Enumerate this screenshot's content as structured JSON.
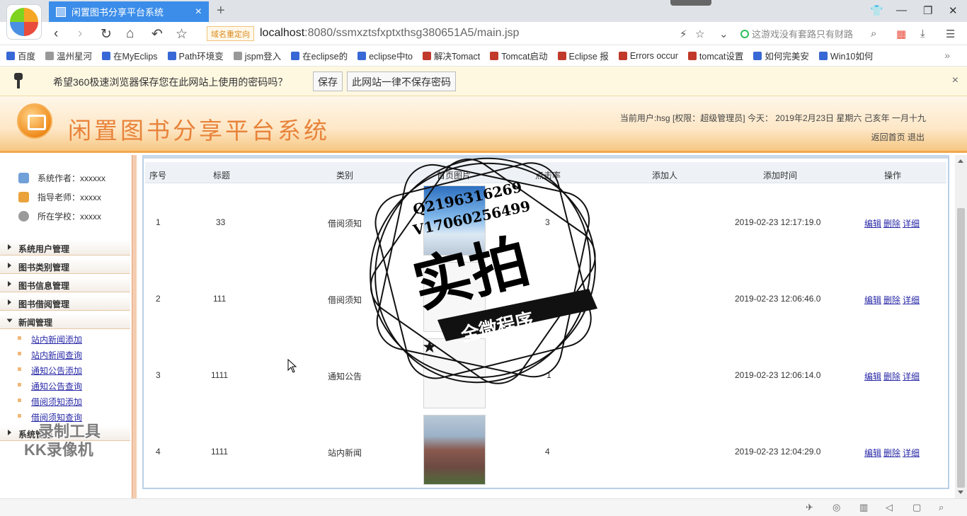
{
  "browser": {
    "tab_title": "闲置图书分享平台系统",
    "tab_close": "×",
    "new_tab": "+",
    "redirect_badge": "域名重定向",
    "url_host": "localhost",
    "url_path": ":8080/ssmxztsfxptxthsg380651A5/main.jsp",
    "search_placeholder": "这游戏没有套路只有财路",
    "bookmarks": [
      {
        "label": "百度",
        "color": "#3867d6"
      },
      {
        "label": "温州星河",
        "color": "#999999"
      },
      {
        "label": "在MyEclips",
        "color": "#3867d6"
      },
      {
        "label": "Path环境变",
        "color": "#3867d6"
      },
      {
        "label": "jspm登入",
        "color": "#999999"
      },
      {
        "label": "在eclipse的",
        "color": "#3867d6"
      },
      {
        "label": "eclipse中to",
        "color": "#3867d6"
      },
      {
        "label": "解决Tomact",
        "color": "#c0392b"
      },
      {
        "label": "Tomcat启动",
        "color": "#c0392b"
      },
      {
        "label": "Eclipse 报",
        "color": "#c0392b"
      },
      {
        "label": "Errors occur",
        "color": "#c0392b"
      },
      {
        "label": "tomcat设置",
        "color": "#c0392b"
      },
      {
        "label": "如何完美安",
        "color": "#3867d6"
      },
      {
        "label": "Win10如何",
        "color": "#3867d6"
      }
    ],
    "bookmarks_more": "»",
    "password_prompt": "希望360极速浏览器保存您在此网站上使用的密码吗？",
    "save_label": "保存",
    "never_save_label": "此网站一律不保存密码",
    "close_glyph": "×"
  },
  "app": {
    "title": "闲置图书分享平台系统",
    "user_info": "当前用户:hsg [权限：超级管理员] 今天： 2019年2月23日 星期六 己亥年 一月十九",
    "back_home": "返回首页",
    "logout": "退出"
  },
  "sidebar": {
    "info": [
      {
        "label": "系统作者：xxxxxx",
        "icon": "users-icon",
        "color": "#6fa0d8"
      },
      {
        "label": "指导老师：xxxxx",
        "icon": "teacher-icon",
        "color": "#e9a33a"
      },
      {
        "label": "所在学校：xxxxx",
        "icon": "clock-icon",
        "color": "#9a9a9a"
      }
    ],
    "menus": [
      {
        "label": "系统用户管理"
      },
      {
        "label": "图书类别管理"
      },
      {
        "label": "图书信息管理"
      },
      {
        "label": "图书借阅管理"
      },
      {
        "label": "新闻管理"
      },
      {
        "label": "系统管理"
      }
    ],
    "news_links": [
      {
        "label": "站内新闻添加"
      },
      {
        "label": "站内新闻查询"
      },
      {
        "label": "通知公告添加"
      },
      {
        "label": "通知公告查询"
      },
      {
        "label": "借阅须知添加"
      },
      {
        "label": "借阅须知查询"
      }
    ]
  },
  "table": {
    "headers": [
      "序号",
      "标题",
      "类别",
      "首页图片",
      "点击率",
      "添加人",
      "添加时间",
      "操作"
    ],
    "rows": [
      {
        "seq": "1",
        "title": "33",
        "category": "借阅须知",
        "image": "sky",
        "clicks": "3",
        "added_by": "",
        "time": "2019-02-23 12:17:19.0"
      },
      {
        "seq": "2",
        "title": "111",
        "category": "借阅须知",
        "image": "blank",
        "clicks": "",
        "added_by": "",
        "time": "2019-02-23 12:06:46.0"
      },
      {
        "seq": "3",
        "title": "1111",
        "category": "通知公告",
        "image": "blank",
        "clicks": "1",
        "added_by": "",
        "time": "2019-02-23 12:06:14.0"
      },
      {
        "seq": "4",
        "title": "1111",
        "category": "站内新闻",
        "image": "campus",
        "clicks": "4",
        "added_by": "",
        "time": "2019-02-23 12:04:29.0"
      }
    ],
    "ops": {
      "edit": "编辑",
      "delete": "删除",
      "detail": "详细"
    }
  },
  "watermark": {
    "line1": "Q2196316269",
    "line2": "V17060256499",
    "big": "实拍",
    "ribbon": "全微程序"
  },
  "recorder": {
    "line1": "录制工具",
    "line2": "KK录像机"
  }
}
